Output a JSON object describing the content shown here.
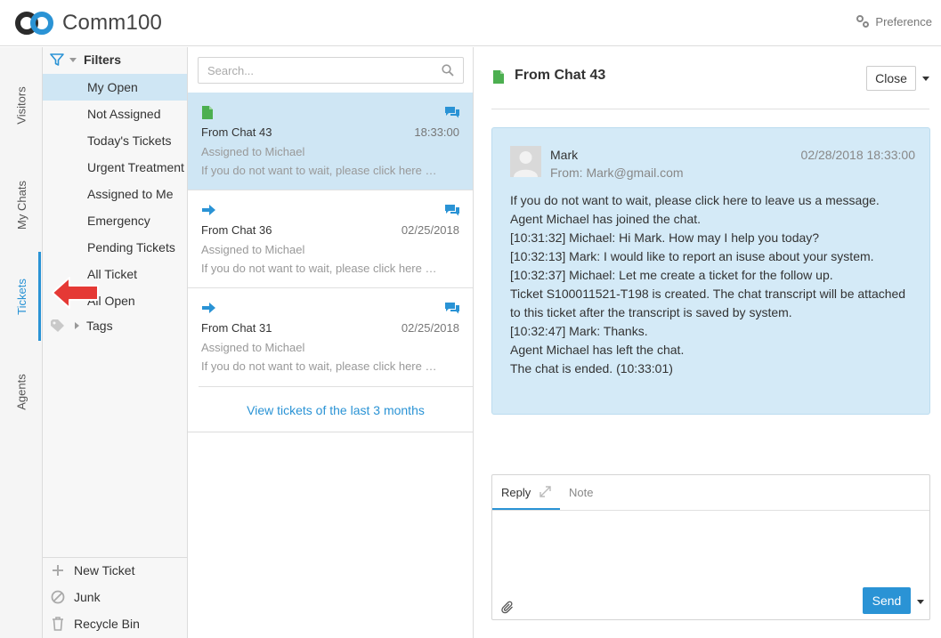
{
  "app": {
    "brand": "Comm100",
    "preference_label": "Preference"
  },
  "nav": {
    "tabs": [
      {
        "label": "Visitors"
      },
      {
        "label": "My Chats"
      },
      {
        "label": "Tickets"
      },
      {
        "label": "Agents"
      }
    ],
    "active": "Tickets"
  },
  "filters": {
    "title": "Filters",
    "items": [
      "My Open",
      "Not Assigned",
      "Today's Tickets",
      "Urgent Treatment",
      "Assigned to Me",
      "Emergency",
      "Pending Tickets",
      "All Ticket",
      "All Open"
    ],
    "selected": "My Open",
    "tags_label": "Tags",
    "actions": [
      "New Ticket",
      "Junk",
      "Recycle Bin"
    ]
  },
  "list": {
    "search_placeholder": "Search...",
    "tickets": [
      {
        "title": "From Chat 43",
        "time": "18:33:00",
        "assigned": "Assigned to Michael",
        "snippet": "If you do not want to wait, please click here to leave us a message.",
        "status_icon": "document-icon"
      },
      {
        "title": "From Chat 36",
        "time": "02/25/2018",
        "assigned": "Assigned to Michael",
        "snippet": "If you do not want to wait, please click here to leave us a message.",
        "status_icon": "arrow-right-icon"
      },
      {
        "title": "From Chat 31",
        "time": "02/25/2018",
        "assigned": "Assigned to Michael",
        "snippet": "If you do not want to wait, please click here to leave us a message.",
        "status_icon": "arrow-right-icon"
      }
    ],
    "view_more": "View tickets of the last 3 months"
  },
  "detail": {
    "title": "From Chat 43",
    "close_label": "Close",
    "message": {
      "name": "Mark",
      "from": "From: Mark@gmail.com",
      "date": "02/28/2018 18:33:00",
      "lines": [
        "If you do not want to wait, please click here to leave us a message.",
        "Agent Michael has joined the chat.",
        "[10:31:32] Michael: Hi Mark. How may I help you today?",
        "[10:32:13] Mark: I would like to report an isuse about your system.",
        "[10:32:37] Michael: Let me create a ticket for the follow up.",
        "Ticket S100011521-T198 is created. The chat transcript will be attached",
        "to this ticket after the transcript is saved by system.",
        "[10:32:47] Mark: Thanks.",
        "Agent Michael has left the chat.",
        "The chat is ended. (10:33:01)"
      ]
    },
    "reply": {
      "tab_reply": "Reply",
      "tab_note": "Note",
      "send_label": "Send"
    }
  },
  "colors": {
    "accent": "#2a93d5",
    "selected_bg": "#cfe6f4",
    "message_bg": "#d4eaf7",
    "arrow": "#e53935",
    "doc_green": "#4caf50"
  }
}
